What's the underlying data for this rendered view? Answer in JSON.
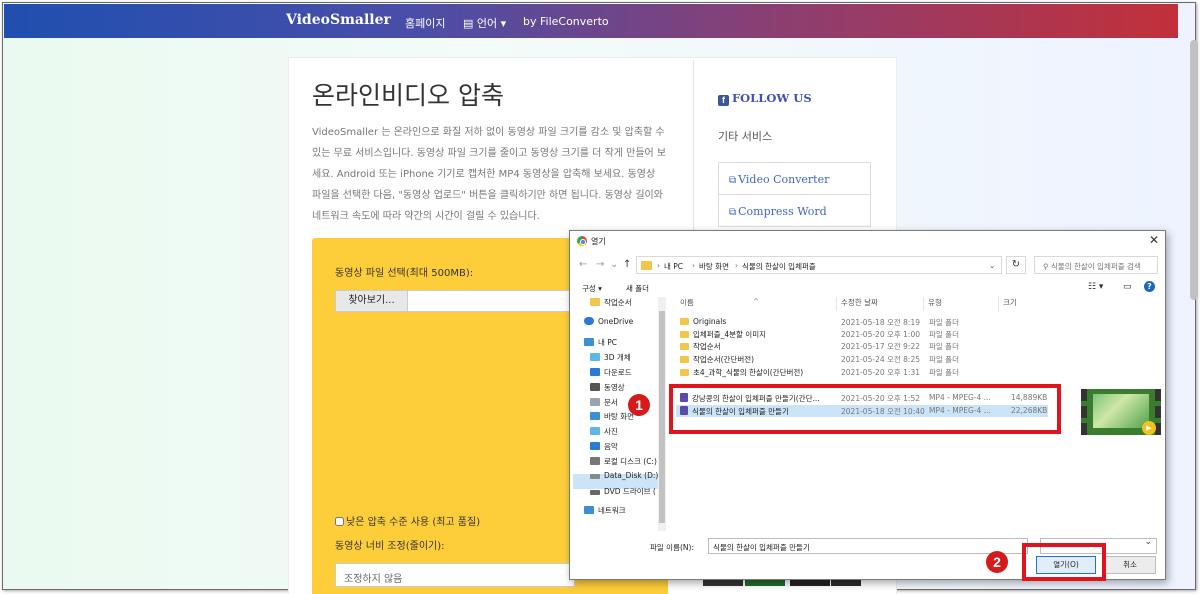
{
  "topnav": {
    "brand": "VideoSmaller",
    "home": "홈페이지",
    "language": "언어",
    "language_caret": "▾",
    "by": "by FileConverto"
  },
  "main": {
    "title": "온라인비디오 압축",
    "intro": "VideoSmaller 는 온라인으로 화질 저하 없이 동영상 파일 크기를 감소 및 압축할 수 있는 무료 서비스입니다. 동영상 파일 크기를 줄이고 동영상 크기를 더 작게 만들어 보세요. Android 또는 iPhone 기기로 캡처한 MP4 동영상을 압축해 보세요. 동영상 파일을 선택한 다음, \"동영상 업로드\" 버튼을 클릭하기만 하면 됩니다. 동영상 길이와 네트워크 속도에 따라 약간의 시간이 걸릴 수 있습니다.",
    "upload_label": "동영상 파일 선택(최대 500MB):",
    "browse": "찾아보기...",
    "low_compression": "낮은 압축 수준 사용 (최고 품질)",
    "width_label": "동영상 너비 조정(줄이기):",
    "width_select": "조정하지 않음"
  },
  "sidebar": {
    "follow": "FOLLOW US",
    "fb_glyph": "f",
    "other_services": "기타 서비스",
    "services": [
      "Video Converter",
      "Compress Word"
    ]
  },
  "dialog": {
    "title": "열기",
    "close": "✕",
    "breadcrumb": [
      "내 PC",
      "바탕 화면",
      "식물의 한살이 입체퍼즐"
    ],
    "search_placeholder": "식물의 한살이 입체퍼즐 검색",
    "toolbar": {
      "organize": "구성 ▾",
      "new_folder": "새 폴더"
    },
    "columns": {
      "name": "이름",
      "date": "수정한 날짜",
      "type": "유형",
      "size": "크기"
    },
    "nav": [
      "작업순서",
      "OneDrive",
      "내 PC",
      "3D 개체",
      "다운로드",
      "동영상",
      "문서",
      "바탕 화면",
      "사진",
      "음악",
      "로컬 디스크 (C:)",
      "Data_Disk (D:)",
      "DVD 드라이브 (",
      "네트워크"
    ],
    "folders": [
      {
        "name": "Originals",
        "date": "2021-05-18 오전 8:19",
        "type": "파일 폴더"
      },
      {
        "name": "입체퍼즐_4분할 이미지",
        "date": "2021-05-20 오후 1:00",
        "type": "파일 폴더"
      },
      {
        "name": "작업순서",
        "date": "2021-05-17 오전 9:22",
        "type": "파일 폴더"
      },
      {
        "name": "작업순서(간단버전)",
        "date": "2021-05-24 오전 8:25",
        "type": "파일 폴더"
      },
      {
        "name": "초4_과학_식물의 한살이(간단버전)",
        "date": "2021-05-20 오후 1:31",
        "type": "파일 폴더"
      }
    ],
    "videos": [
      {
        "name": "강낭콩의 한살이 입체퍼즐 만들기(간단...",
        "date": "2021-05-20 오후 1:52",
        "type": "MP4 - MPEG-4 ...",
        "size": "14,889KB"
      },
      {
        "name": "식물의 한살이 입체퍼즐 만들기",
        "date": "2021-05-18 오전 10:40",
        "type": "MP4 - MPEG-4 ...",
        "size": "22,268KB"
      }
    ],
    "filename_label": "파일 이름(N):",
    "filename_value": "식물의 한살이 입체퍼즐 만들기",
    "open": "열기(O)",
    "cancel": "취소"
  },
  "callouts": {
    "one": "1",
    "two": "2"
  },
  "colors": {
    "accent_red": "#e0141c",
    "nav_start": "#1f4fb0",
    "nav_end": "#c2303a",
    "upload_bg": "#fece3a"
  }
}
